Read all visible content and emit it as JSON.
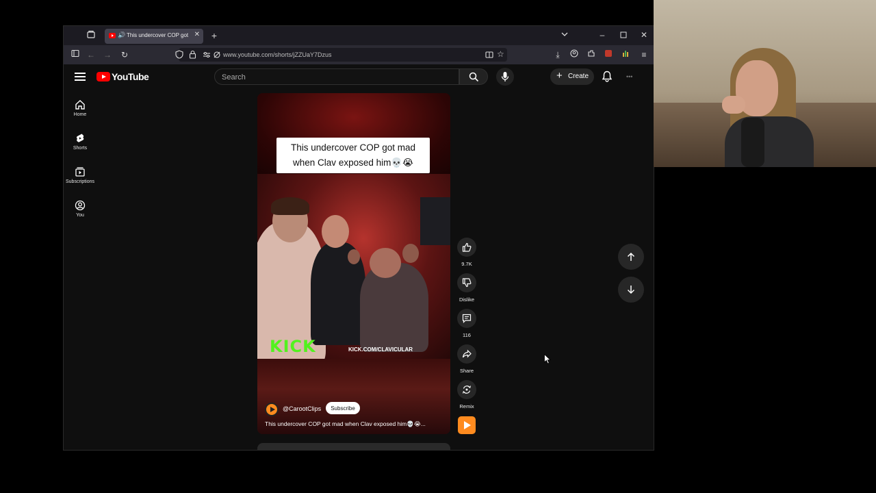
{
  "browser": {
    "tab_title": "This undercover COP got m",
    "url": "www.youtube.com/shorts/jZZUaY7Dzus"
  },
  "header": {
    "brand": "YouTube",
    "search_placeholder": "Search",
    "create_label": "Create",
    "avatar_placeholder": "•••"
  },
  "sidebar": {
    "items": [
      {
        "label": "Home",
        "icon": "home-icon"
      },
      {
        "label": "Shorts",
        "icon": "shorts-icon"
      },
      {
        "label": "Subscriptions",
        "icon": "subscriptions-icon"
      },
      {
        "label": "You",
        "icon": "you-icon"
      }
    ]
  },
  "short": {
    "caption_line1": "This undercover COP got mad",
    "caption_line2": "when Clav exposed him💀😭",
    "overlay_brand": "KICK",
    "overlay_url": "KICK.COM/CLAVICULAR",
    "channel": "@CarootClips",
    "subscribe_label": "Subscribe",
    "description": "This undercover COP got mad when Clav exposed him💀😭..."
  },
  "actions": {
    "likes": "9.7K",
    "dislike_label": "Dislike",
    "comments": "116",
    "share_label": "Share",
    "remix_label": "Remix"
  },
  "colors": {
    "brand_red": "#ff0000",
    "kick_green": "#52f21e",
    "background": "#0f0f0f"
  }
}
